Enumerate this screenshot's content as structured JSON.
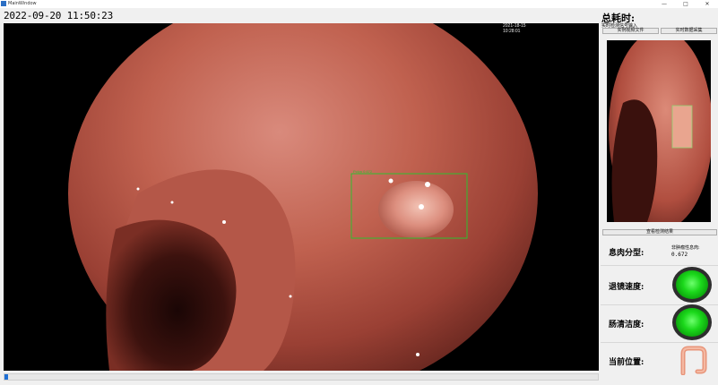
{
  "window": {
    "title": "MainWindow",
    "minimize": "—",
    "maximize": "□",
    "close": "✕"
  },
  "datetime": "2022-09-20 11:50:23",
  "video": {
    "timestamp_date": "2021-18-15",
    "timestamp_time": "10:28:01",
    "detection_label": "Polyp 0.672",
    "progress": 0.006
  },
  "panel": {
    "title": "总耗时:",
    "input_label": "实时检测信号输入",
    "buttons": {
      "video_file": "实例视频文件",
      "realtime_capture": "实时数据采集",
      "view_result": "查看检测结果"
    },
    "polyp_class_label": "息肉分型:",
    "polyp_class_name": "非肿瘤性息肉:",
    "polyp_class_score": "0.672",
    "withdrawal_speed_label": "退镜速度:",
    "bowel_prep_label": "肠清洁度:",
    "position_label": "当前位置:"
  },
  "colors": {
    "indicator_ok": "#1bd81b",
    "progress": "#1f6fd4",
    "detection_box": "#2fbf2f"
  },
  "icons": {
    "colon": "colon-icon",
    "app": "app-icon"
  }
}
